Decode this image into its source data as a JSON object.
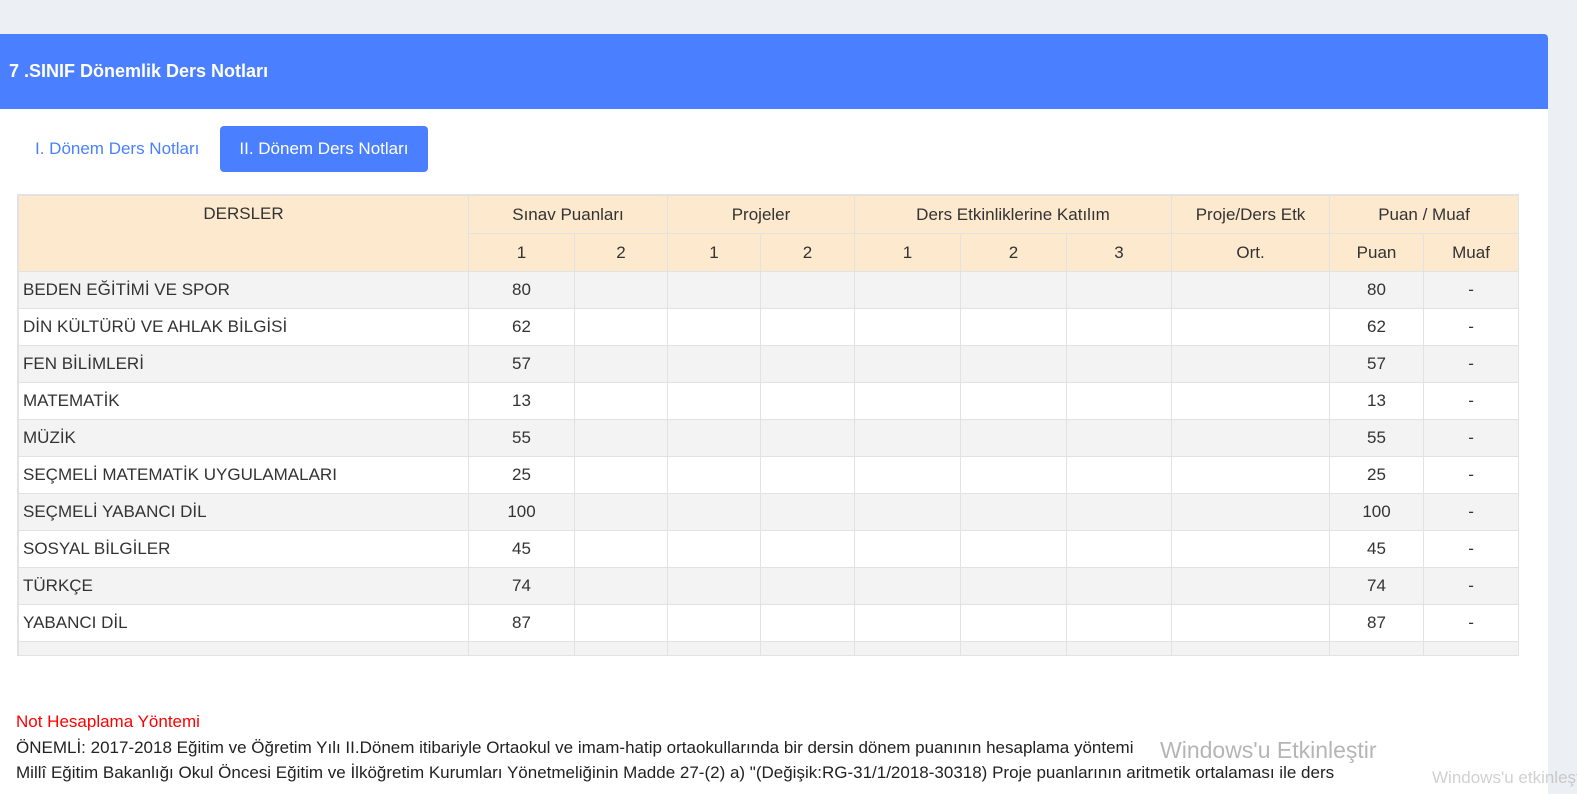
{
  "header": {
    "title": "7 .SINIF Dönemlik Ders Notları"
  },
  "tabs": [
    {
      "label": "I. Dönem Ders Notları",
      "active": false
    },
    {
      "label": "II. Dönem Ders Notları",
      "active": true
    }
  ],
  "table": {
    "group_headers": [
      "DERSLER",
      "Sınav Puanları",
      "Projeler",
      "Ders Etkinliklerine Katılım",
      "Proje/Ders Etk",
      "Puan / Muaf"
    ],
    "sub_headers": [
      "1",
      "2",
      "1",
      "2",
      "1",
      "2",
      "3",
      "Ort.",
      "Puan",
      "Muaf"
    ],
    "rows": [
      {
        "lesson": "BEDEN EĞİTİMİ VE SPOR",
        "s1": "80",
        "puan": "80",
        "muaf": "-"
      },
      {
        "lesson": "DİN KÜLTÜRÜ VE AHLAK BİLGİSİ",
        "s1": "62",
        "puan": "62",
        "muaf": "-"
      },
      {
        "lesson": "FEN BİLİMLERİ",
        "s1": "57",
        "puan": "57",
        "muaf": "-"
      },
      {
        "lesson": "MATEMATİK",
        "s1": "13",
        "puan": "13",
        "muaf": "-"
      },
      {
        "lesson": "MÜZİK",
        "s1": "55",
        "puan": "55",
        "muaf": "-"
      },
      {
        "lesson": "SEÇMELİ MATEMATİK UYGULAMALARI",
        "s1": "25",
        "puan": "25",
        "muaf": "-"
      },
      {
        "lesson": "SEÇMELİ YABANCI DİL",
        "s1": "100",
        "puan": "100",
        "muaf": "-"
      },
      {
        "lesson": "SOSYAL BİLGİLER",
        "s1": "45",
        "puan": "45",
        "muaf": "-"
      },
      {
        "lesson": "TÜRKÇE",
        "s1": "74",
        "puan": "74",
        "muaf": "-"
      },
      {
        "lesson": "YABANCI DİL",
        "s1": "87",
        "puan": "87",
        "muaf": "-"
      }
    ]
  },
  "note": {
    "title": "Not Hesaplama Yöntemi",
    "line1": "ÖNEMLİ: 2017-2018 Eğitim ve Öğretim Yılı II.Dönem itibariyle Ortaokul ve imam-hatip ortaokullarında bir dersin dönem puanının hesaplama yöntemi",
    "line2": "Millî Eğitim Bakanlığı Okul Öncesi Eğitim ve İlköğretim Kurumları Yönetmeliğinin Madde 27-(2) a) \"(Değişik:RG-31/1/2018-30318) Proje puanlarının aritmetik ortalaması ile ders"
  },
  "watermark": {
    "title": "Windows'u Etkinleştir",
    "subtitle": "Windows'u etkinleştirmek için Ayarlar'a gidin."
  },
  "colors": {
    "primary": "#4a80ff",
    "table_header_bg": "#fde9ce",
    "note_title": "#ff0000"
  }
}
